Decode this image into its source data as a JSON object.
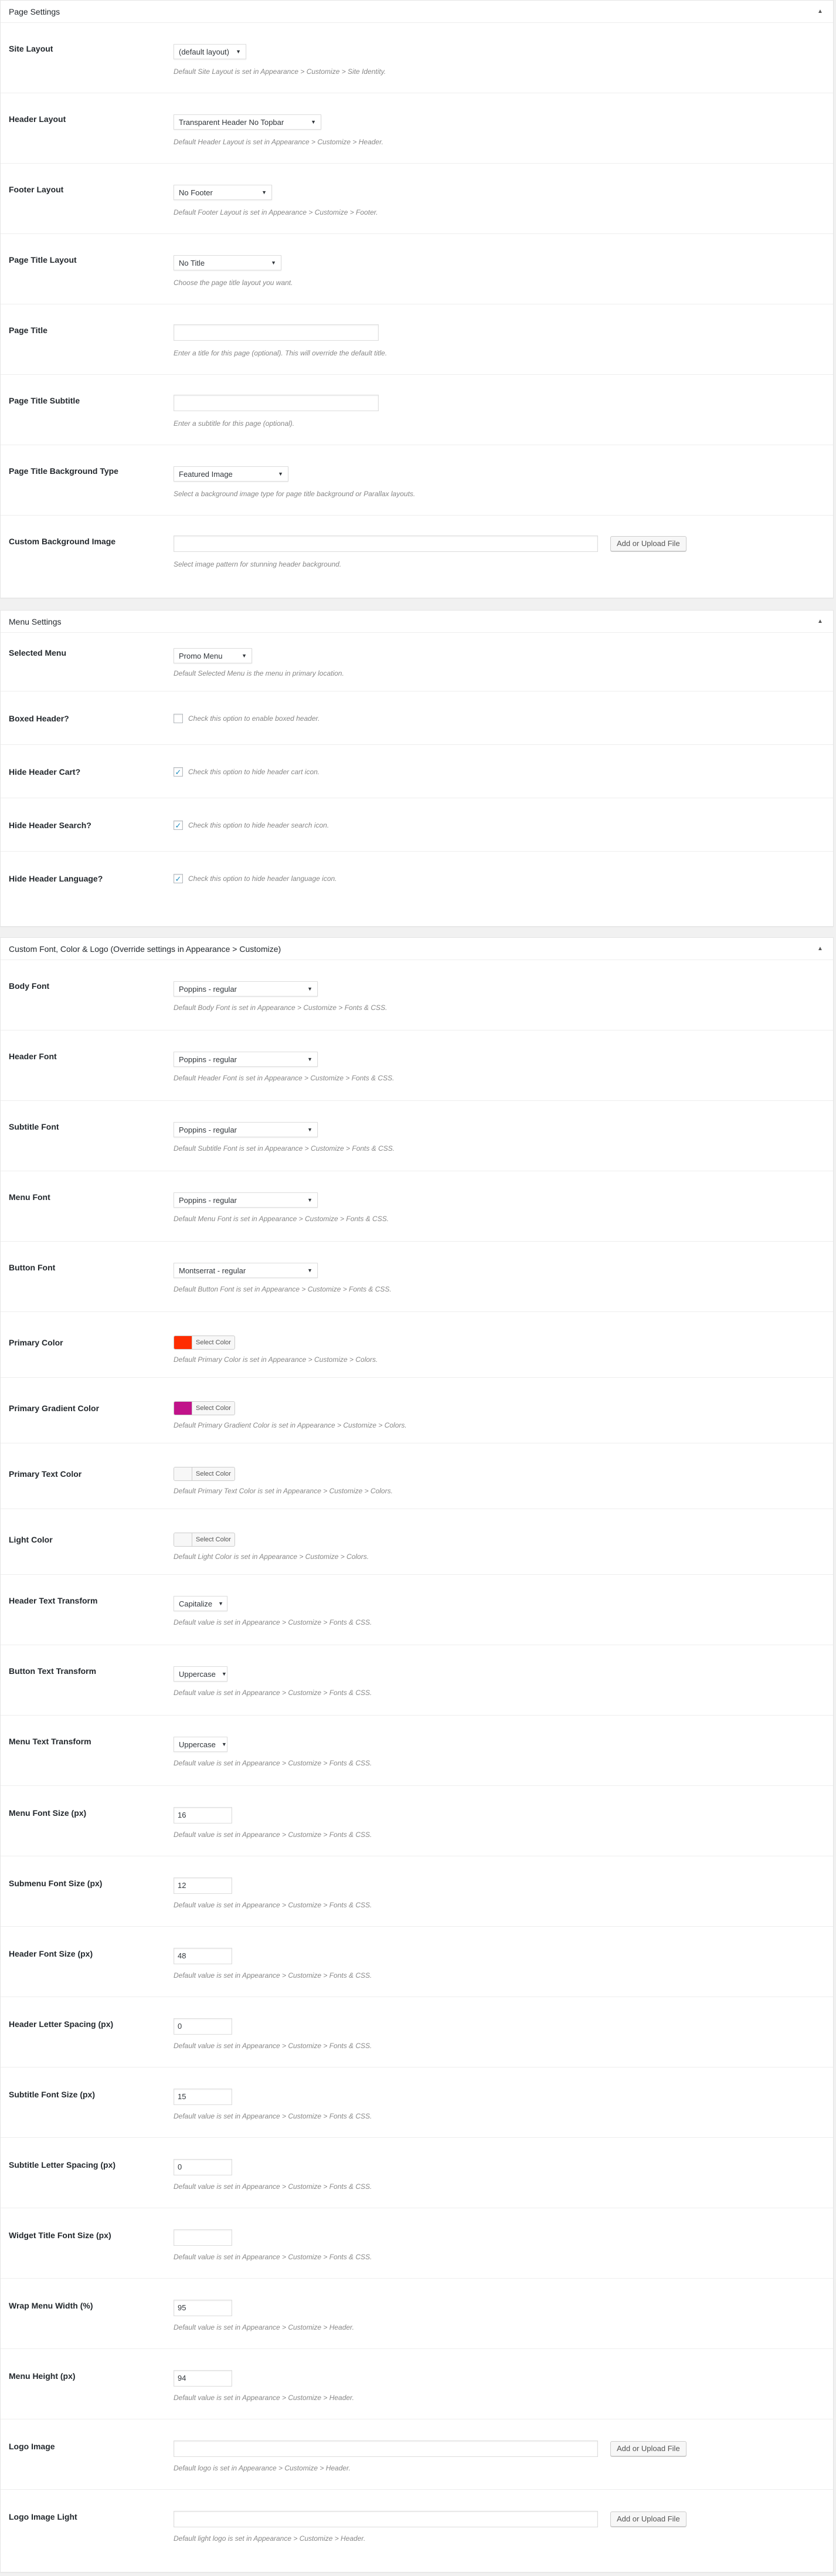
{
  "page_settings": {
    "title": "Page Settings",
    "toggle": "▲",
    "site_layout": {
      "label": "Site Layout",
      "value": "(default layout)",
      "desc": "Default Site Layout is set in Appearance > Customize > Site Identity."
    },
    "header_layout": {
      "label": "Header Layout",
      "value": "Transparent Header No Topbar",
      "desc": "Default Header Layout is set in Appearance > Customize > Header."
    },
    "footer_layout": {
      "label": "Footer Layout",
      "value": "No Footer",
      "desc": "Default Footer Layout is set in Appearance > Customize > Footer."
    },
    "page_title_layout": {
      "label": "Page Title Layout",
      "value": "No Title",
      "desc": "Choose the page title layout you want."
    },
    "page_title": {
      "label": "Page Title",
      "value": "",
      "desc": "Enter a title for this page (optional). This will override the default title."
    },
    "page_title_subtitle": {
      "label": "Page Title Subtitle",
      "value": "",
      "desc": "Enter a subtitle for this page (optional)."
    },
    "page_title_bg_type": {
      "label": "Page Title Background Type",
      "value": "Featured Image",
      "desc": "Select a background image type for page title background or Parallax layouts."
    },
    "custom_bg_image": {
      "label": "Custom Background Image",
      "value": "",
      "button": "Add or Upload File",
      "desc": "Select image pattern for stunning header background."
    }
  },
  "menu_settings": {
    "title": "Menu Settings",
    "toggle": "▲",
    "selected_menu": {
      "label": "Selected Menu",
      "value": "Promo Menu",
      "desc": "Default Selected Menu is the menu in primary location."
    },
    "boxed_header": {
      "label": "Boxed Header?",
      "checked": "",
      "desc": "Check this option to enable boxed header."
    },
    "hide_cart": {
      "label": "Hide Header Cart?",
      "checked": "✓",
      "desc": "Check this option to hide header cart icon."
    },
    "hide_search": {
      "label": "Hide Header Search?",
      "checked": "✓",
      "desc": "Check this option to hide header search icon."
    },
    "hide_language": {
      "label": "Hide Header Language?",
      "checked": "✓",
      "desc": "Check this option to hide header language icon."
    }
  },
  "custom_font": {
    "title": "Custom Font, Color & Logo (Override settings in Appearance > Customize)",
    "toggle": "▲",
    "body_font": {
      "label": "Body Font",
      "value": "Poppins - regular",
      "desc": "Default Body Font is set in Appearance > Customize > Fonts & CSS."
    },
    "header_font": {
      "label": "Header Font",
      "value": "Poppins - regular",
      "desc": "Default Header Font is set in Appearance > Customize > Fonts & CSS."
    },
    "subtitle_font": {
      "label": "Subtitle Font",
      "value": "Poppins - regular",
      "desc": "Default Subtitle Font is set in Appearance > Customize > Fonts & CSS."
    },
    "menu_font": {
      "label": "Menu Font",
      "value": "Poppins - regular",
      "desc": "Default Menu Font is set in Appearance > Customize > Fonts & CSS."
    },
    "button_font": {
      "label": "Button Font",
      "value": "Montserrat - regular",
      "desc": "Default Button Font is set in Appearance > Customize > Fonts & CSS."
    },
    "primary_color": {
      "label": "Primary Color",
      "button": "Select Color",
      "color": "#ff2d00",
      "desc": "Default Primary Color is set in Appearance > Customize > Colors."
    },
    "primary_gradient": {
      "label": "Primary Gradient Color",
      "button": "Select Color",
      "color": "#c1138a",
      "desc": "Default Primary Gradient Color is set in Appearance > Customize > Colors."
    },
    "primary_text": {
      "label": "Primary Text Color",
      "button": "Select Color",
      "color": "#f7f7f7",
      "desc": "Default Primary Text Color is set in Appearance > Customize > Colors."
    },
    "light_color": {
      "label": "Light Color",
      "button": "Select Color",
      "color": "#f7f7f7",
      "desc": "Default Light Color is set in Appearance > Customize > Colors."
    },
    "header_text_transform": {
      "label": "Header Text Transform",
      "value": "Capitalize",
      "desc": "Default value is set in Appearance > Customize > Fonts & CSS."
    },
    "button_text_transform": {
      "label": "Button Text Transform",
      "value": "Uppercase",
      "desc": "Default value is set in Appearance > Customize > Fonts & CSS."
    },
    "menu_text_transform": {
      "label": "Menu Text Transform",
      "value": "Uppercase",
      "desc": "Default value is set in Appearance > Customize > Fonts & CSS."
    },
    "menu_font_size": {
      "label": "Menu Font Size (px)",
      "value": "16",
      "desc": "Default value is set in Appearance > Customize > Fonts & CSS."
    },
    "submenu_font_size": {
      "label": "Submenu Font Size (px)",
      "value": "12",
      "desc": "Default value is set in Appearance > Customize > Fonts & CSS."
    },
    "header_font_size": {
      "label": "Header Font Size (px)",
      "value": "48",
      "desc": "Default value is set in Appearance > Customize > Fonts & CSS."
    },
    "header_letter_spacing": {
      "label": "Header Letter Spacing (px)",
      "value": "0",
      "desc": "Default value is set in Appearance > Customize > Fonts & CSS."
    },
    "subtitle_font_size": {
      "label": "Subtitle Font Size (px)",
      "value": "15",
      "desc": "Default value is set in Appearance > Customize > Fonts & CSS."
    },
    "subtitle_letter_spacing": {
      "label": "Subtitle Letter Spacing (px)",
      "value": "0",
      "desc": "Default value is set in Appearance > Customize > Fonts & CSS."
    },
    "widget_title_font_size": {
      "label": "Widget Title Font Size (px)",
      "value": "",
      "desc": "Default value is set in Appearance > Customize > Fonts & CSS."
    },
    "wrap_menu_width": {
      "label": "Wrap Menu Width (%)",
      "value": "95",
      "desc": "Default value is set in Appearance > Customize > Header."
    },
    "menu_height": {
      "label": "Menu Height (px)",
      "value": "94",
      "desc": "Default value is set in Appearance > Customize > Header."
    },
    "logo_image": {
      "label": "Logo Image",
      "value": "",
      "button": "Add or Upload File",
      "desc": "Default logo is set in Appearance > Customize > Header."
    },
    "logo_image_light": {
      "label": "Logo Image Light",
      "value": "",
      "button": "Add or Upload File",
      "desc": "Default light logo is set in Appearance > Customize > Header."
    }
  }
}
